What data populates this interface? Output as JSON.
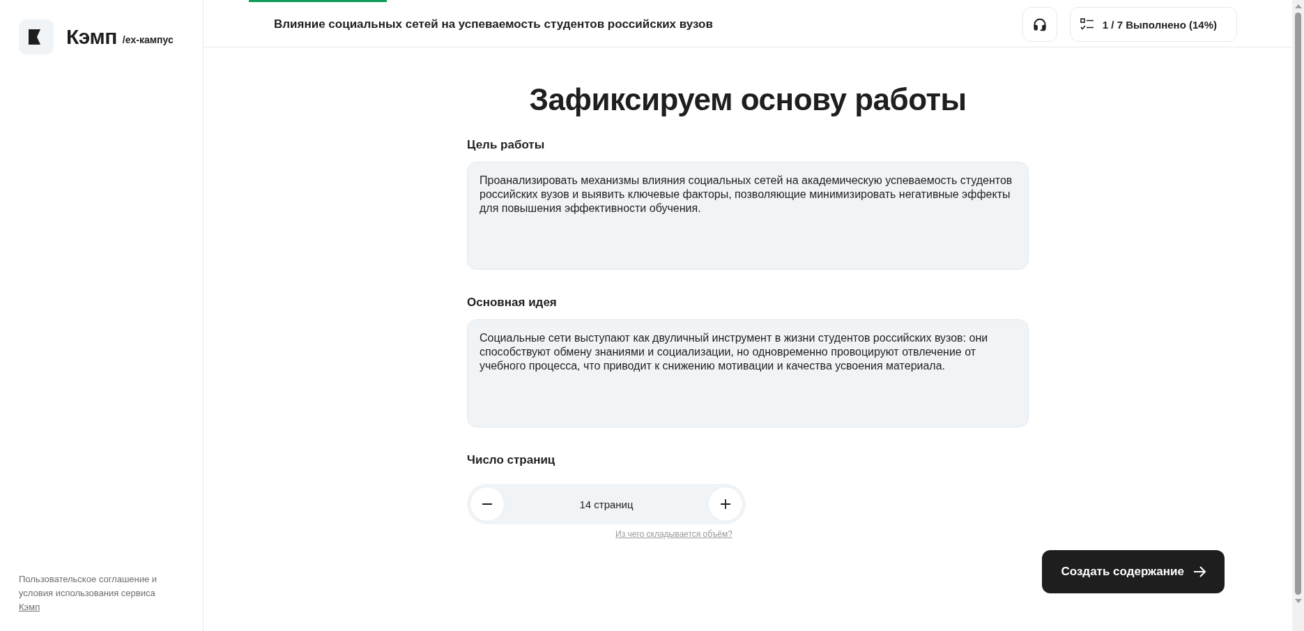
{
  "brand": {
    "name": "Кэмп",
    "tagline": "/ex-кампус"
  },
  "sidebar": {
    "footer_text": "Пользовательское соглашение и условия использования сервиса",
    "footer_link": "Кэмп"
  },
  "header": {
    "progress": {
      "level": 0.14
    },
    "title": "Влияние социальных сетей на успеваемость студентов российских вузов",
    "status": "1 / 7 Выполнено (14%)"
  },
  "page": {
    "heading": "Зафиксируем основу работы",
    "fields": [
      {
        "label": "Цель работы",
        "value": "Проанализировать механизмы влияния социальных сетей на академическую успеваемость студентов российских вузов и выявить ключевые факторы, позволяющие минимизировать негативные эффекты для повышения эффективности обучения."
      },
      {
        "label": "Основная идея",
        "value": "Социальные сети выступают как двуличный инструмент в жизни студентов российских вузов: они способствуют обмену знаниями и социализации, но одновременно провоцируют отвлечение от учебного процесса, что приводит к снижению мотивации и качества усвоения материала."
      }
    ],
    "pages": {
      "label": "Число страниц",
      "value": "14 страниц",
      "help_link": "Из чего складывается объём?"
    },
    "submit": "Создать содержание"
  }
}
